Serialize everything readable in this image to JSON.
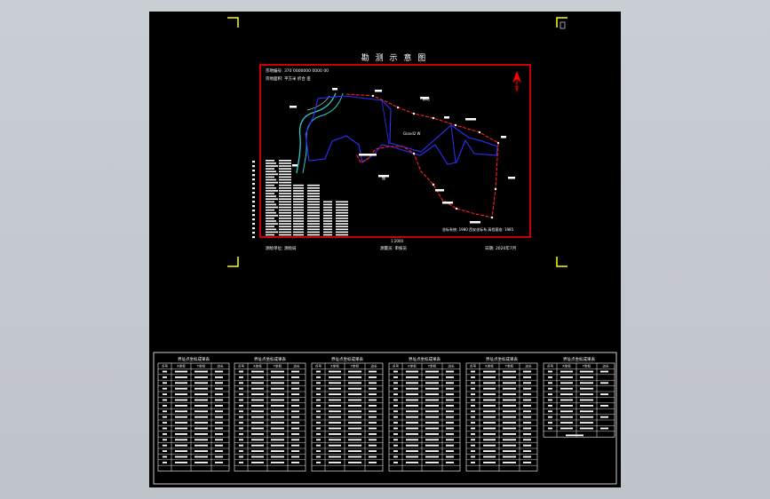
{
  "map": {
    "title": "勘 测 示 意 图",
    "info_line_1": "宗地编号: 370 0000000 0000 00",
    "info_line_2": "宗地面积:  平方米 折合  亩",
    "north_letter": "N",
    "scale": "1:2000",
    "footer_left": "测绘单位: 测绘局",
    "footer_mid": "测量员: 审核员",
    "footer_right": "日期: 2020年7月",
    "plot_label": "Gland2  W",
    "place_label_1": "耕地",
    "place_label_2": "路",
    "bottom_note": "坐标系统: 1980 西安坐标系  高程基准: 1985"
  },
  "tables": [
    {
      "title": "界址点坐标成果表",
      "headers": [
        "点号",
        "X坐标",
        "Y坐标",
        "边长"
      ]
    },
    {
      "title": "界址点坐标成果表",
      "headers": [
        "点号",
        "X坐标",
        "Y坐标",
        "边长"
      ]
    },
    {
      "title": "界址点坐标成果表",
      "headers": [
        "点号",
        "X坐标",
        "Y坐标",
        "边长"
      ]
    },
    {
      "title": "界址点坐标成果表",
      "headers": [
        "点号",
        "X坐标",
        "Y坐标",
        "边长"
      ]
    },
    {
      "title": "界址点坐标成果表",
      "headers": [
        "点号",
        "X坐标",
        "Y坐标",
        "边长"
      ]
    },
    {
      "title": "界址点坐标成果表",
      "headers": [
        "点号",
        "X坐标",
        "Y坐标",
        "边长"
      ]
    }
  ],
  "colors": {
    "frame": "#ff0000",
    "boundary": "#ff2020",
    "parcel": "#2f2fff",
    "river": "#33cccc",
    "corner_marks": "#ffff00",
    "lines": "#ffffff"
  }
}
